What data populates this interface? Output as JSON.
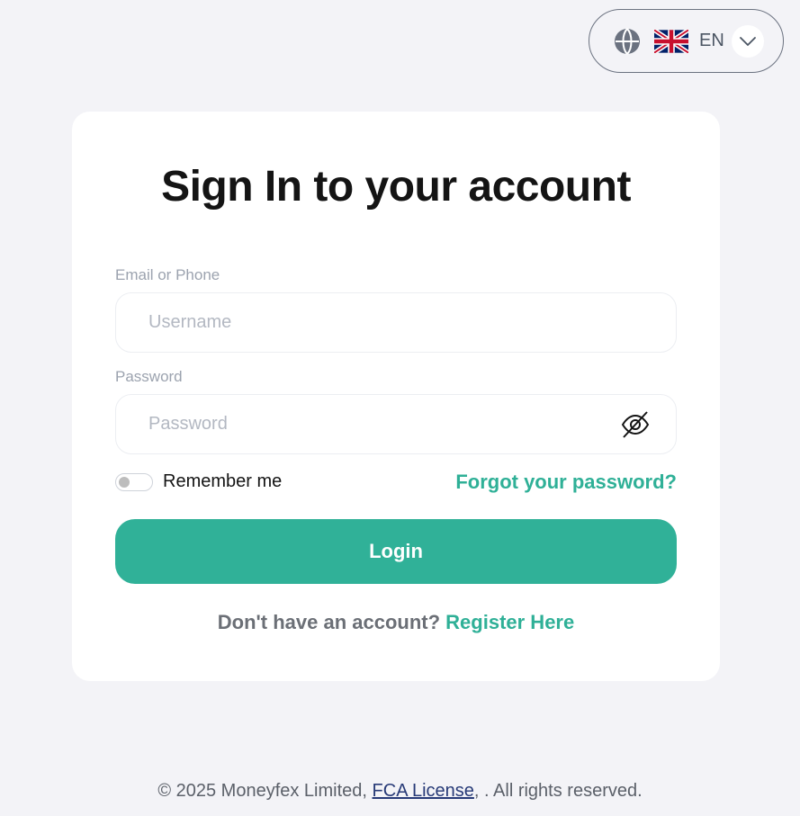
{
  "language": {
    "code": "EN",
    "globe_icon": "globe-icon",
    "flag_icon": "uk-flag-icon",
    "chevron_icon": "chevron-down-icon"
  },
  "card": {
    "title": "Sign In to your account",
    "email_label": "Email or Phone",
    "username_placeholder": "Username",
    "password_label": "Password",
    "password_placeholder": "Password",
    "eye_icon": "eye-slash-icon",
    "remember_label": "Remember me",
    "forgot_link": "Forgot your password?",
    "login_button": "Login",
    "no_account_text": "Don't have an account?",
    "register_link": "Register Here"
  },
  "footer": {
    "copyright": "© 2025 Moneyfex Limited, ",
    "license_link": "FCA License",
    "rights": ", . All rights reserved."
  },
  "colors": {
    "accent": "#30b198",
    "background": "#f3f3f7",
    "card": "#ffffff",
    "link_dark": "#273a77"
  }
}
